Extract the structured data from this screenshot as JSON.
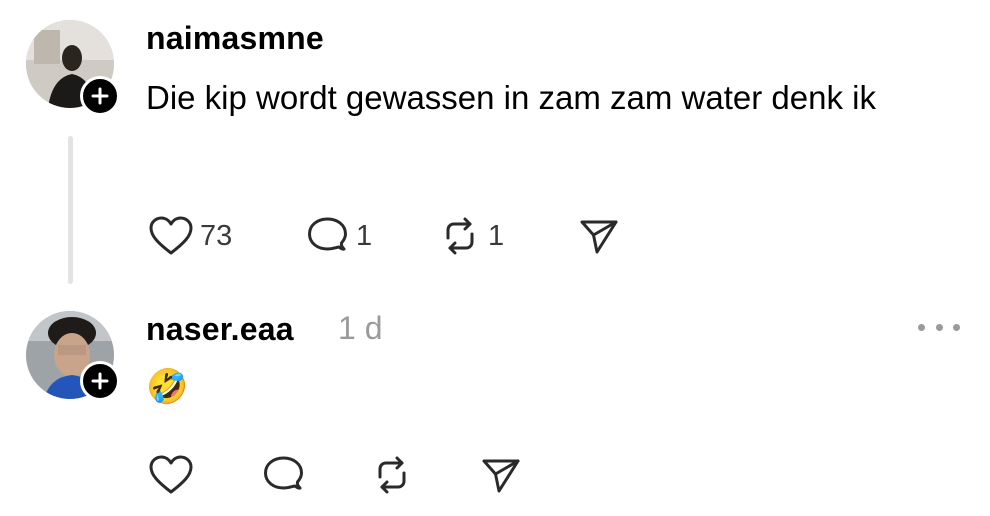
{
  "posts": [
    {
      "username": "naimasmne",
      "timestamp": "",
      "text": "Die kip wordt gewassen in zam zam water denk ik",
      "actions": {
        "like_count": "73",
        "reply_count": "1",
        "repost_count": "1"
      }
    },
    {
      "username": "naser.eaa",
      "timestamp": "1 d",
      "text": "🤣",
      "actions": {
        "like_count": "",
        "reply_count": "",
        "repost_count": ""
      }
    }
  ],
  "icons": {
    "like": "heart-icon",
    "reply": "speech-bubble-icon",
    "repost": "repost-icon",
    "share": "paper-plane-icon",
    "follow": "plus-icon",
    "more": "more-dots-icon"
  },
  "colors": {
    "text": "#000000",
    "muted": "#9a9a9a",
    "thread_line": "#e3e3e3"
  }
}
